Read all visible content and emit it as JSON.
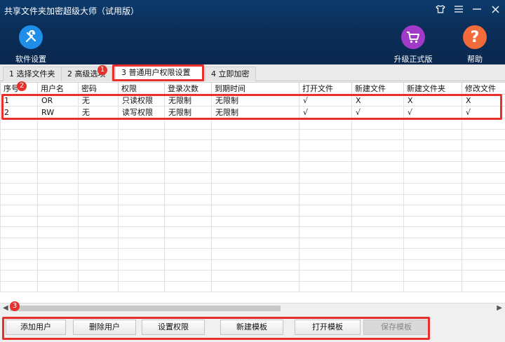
{
  "window": {
    "title": "共享文件夹加密超级大师（试用版）"
  },
  "toolbar": {
    "settings_label": "软件设置",
    "upgrade_label": "升级正式版",
    "help_label": "帮助"
  },
  "tabs": [
    {
      "label": "1 选择文件夹"
    },
    {
      "label": "2 高级选项"
    },
    {
      "label": "3 普通用户权限设置"
    },
    {
      "label": "4 立即加密"
    }
  ],
  "table": {
    "headers": [
      "序号",
      "用户名",
      "密码",
      "权限",
      "登录次数",
      "到期时间",
      "打开文件",
      "新建文件",
      "新建文件夹",
      "修改文件"
    ],
    "rows": [
      [
        "1",
        "OR",
        "无",
        "只读权限",
        "无限制",
        "无限制",
        "√",
        "X",
        "X",
        "X"
      ],
      [
        "2",
        "RW",
        "无",
        "读写权限",
        "无限制",
        "无限制",
        "√",
        "√",
        "√",
        "√"
      ]
    ]
  },
  "buttons": {
    "add_user": "添加用户",
    "delete_user": "删除用户",
    "set_permission": "设置权限",
    "new_template": "新建模板",
    "open_template": "打开模板",
    "save_template": "保存模板"
  },
  "annotations": {
    "badge1": "1",
    "badge2": "2",
    "badge3": "3"
  },
  "colors": {
    "header_bg": "#0b2e58",
    "annotation_red": "#e8302b"
  }
}
